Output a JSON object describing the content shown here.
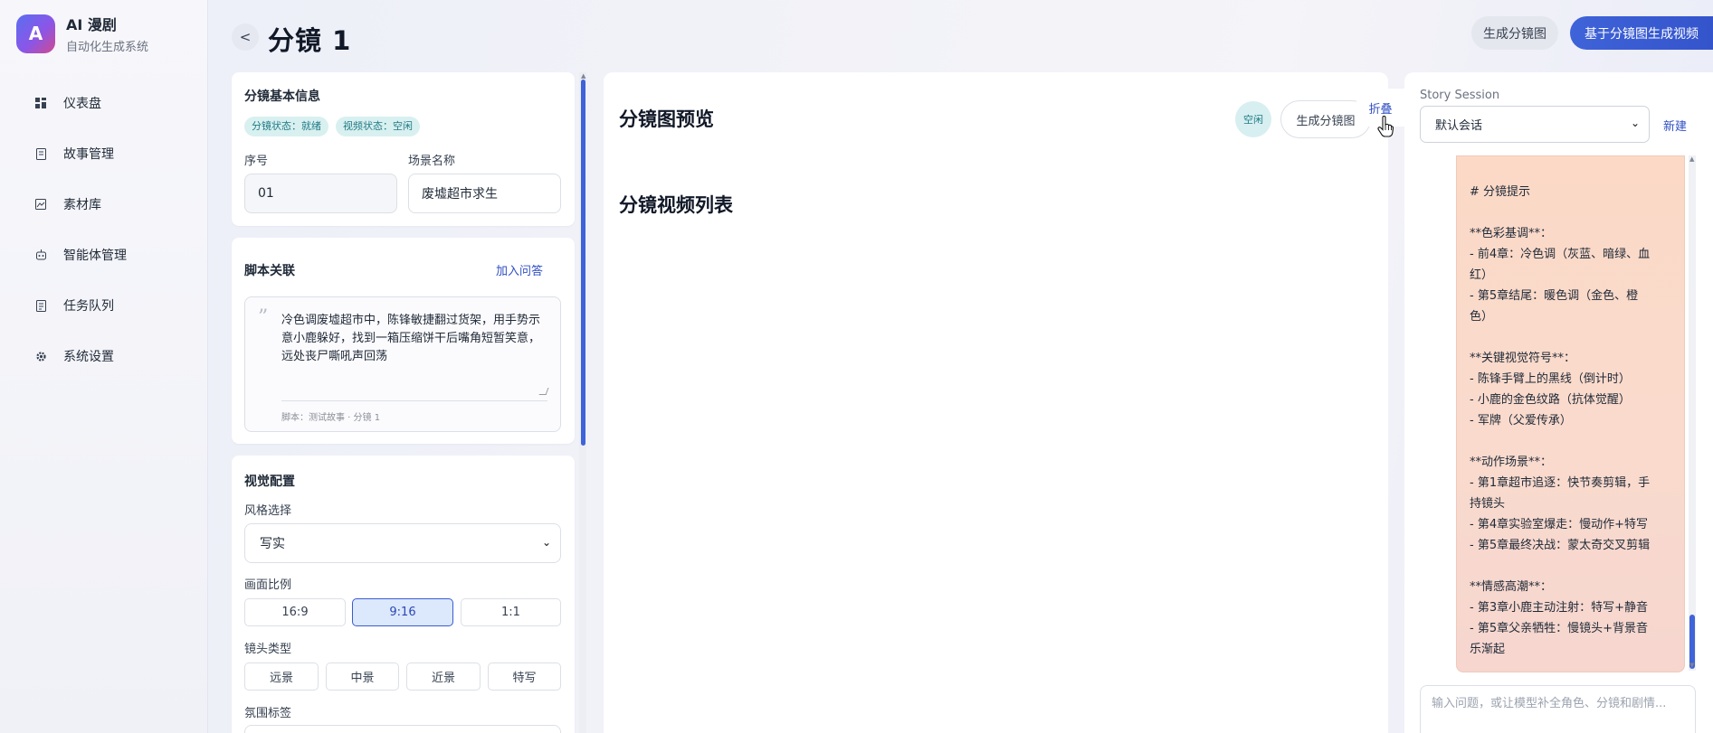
{
  "brand": {
    "logo_letter": "A",
    "title": "AI 漫剧",
    "subtitle": "自动化生成系统"
  },
  "nav": [
    {
      "icon": "dashboard-icon",
      "label": "仪表盘"
    },
    {
      "icon": "book-icon",
      "label": "故事管理"
    },
    {
      "icon": "image-icon",
      "label": "素材库"
    },
    {
      "icon": "robot-icon",
      "label": "智能体管理"
    },
    {
      "icon": "list-icon",
      "label": "任务队列"
    },
    {
      "icon": "gear-icon",
      "label": "系统设置"
    }
  ],
  "header": {
    "back_label": "<",
    "title": "分镜 1",
    "btn_generate_storyboard": "生成分镜图",
    "btn_generate_video": "基于分镜图生成视频"
  },
  "basic_info": {
    "title": "分镜基本信息",
    "tags": [
      "分镜状态：就绪",
      "视频状态：空闲"
    ],
    "seq_label": "序号",
    "seq_value": "01",
    "scene_label": "场景名称",
    "scene_value": "废墟超市求生"
  },
  "script": {
    "title": "脚本关联",
    "add_link": "加入问答",
    "quote_mark": "”",
    "text": "冷色调废墟超市中，陈锋敏捷翻过货架，用手势示意小鹿躲好，找到一箱压缩饼干后嘴角短暂笑意，远处丧尸嘶吼声回荡",
    "meta": "脚本：测试故事 · 分镜 1"
  },
  "visual": {
    "title": "视觉配置",
    "style_label": "风格选择",
    "style_value": "写实",
    "ratio_label": "画面比例",
    "ratios": [
      "16:9",
      "9:16",
      "1:1"
    ],
    "ratio_selected": "9:16",
    "shot_label": "镜头类型",
    "shots": [
      "远景",
      "中景",
      "近景",
      "特写"
    ],
    "mood_label": "氛围标签"
  },
  "preview": {
    "title": "分镜图预览",
    "idle_badge": "空闲",
    "gen_btn": "生成分镜图",
    "fold_btn": "折叠",
    "video_list_title": "分镜视频列表"
  },
  "session": {
    "label": "Story Session",
    "selected": "默认会话",
    "new_link": "新建",
    "message_lines": [
      "# 分镜提示",
      "",
      "**色彩基调**：",
      "- 前4章：冷色调（灰蓝、暗绿、血",
      "红）",
      "- 第5章结尾：暖色调（金色、橙",
      "色）",
      "",
      "**关键视觉符号**：",
      "- 陈锋手臂上的黑线（倒计时）",
      "- 小鹿的金色纹路（抗体觉醒）",
      "- 军牌（父爱传承）",
      "",
      "**动作场景**：",
      "- 第1章超市追逐：快节奏剪辑，手",
      "持镜头",
      "- 第4章实验室爆走：慢动作+特写",
      "- 第5章最终决战：蒙太奇交叉剪辑",
      "",
      "**情感高潮**：",
      "- 第3章小鹿主动注射：特写+静音",
      "- 第5章父亲牺牲：慢镜头+背景音",
      "乐渐起"
    ],
    "input_placeholder": "输入问题，或让模型补全角色、分镜和剧情..."
  }
}
